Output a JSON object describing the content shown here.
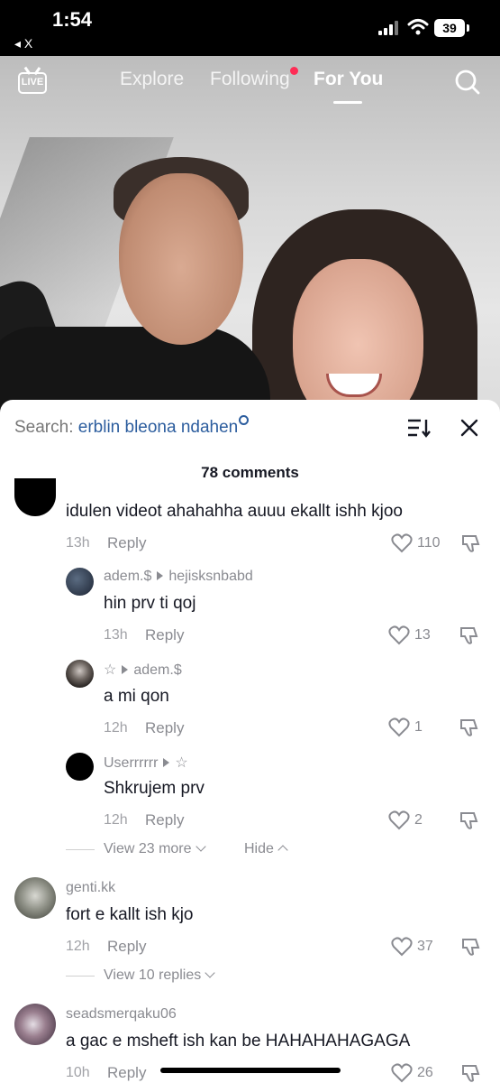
{
  "status": {
    "time": "1:54",
    "back_label": "◂ X",
    "battery": "39"
  },
  "topnav": {
    "tabs": [
      "Explore",
      "Following",
      "For You"
    ],
    "active_tab": "For You",
    "live_label": "LIVE"
  },
  "sheet": {
    "search_prefix": "Search:",
    "search_query": "erblin bleona ndahen",
    "comments_count": "78 comments"
  },
  "comments": [
    {
      "username": "",
      "text": "idulen videot ahahahha auuu ekallt ishh kjoo",
      "time": "13h",
      "reply": "Reply",
      "likes": "110"
    },
    {
      "username": "adem.$",
      "reply_to": "hejisksnbabd",
      "text": "hin prv ti qoj",
      "time": "13h",
      "reply": "Reply",
      "likes": "13"
    },
    {
      "username": "☆",
      "reply_to": "adem.$",
      "text": "a mi qon",
      "time": "12h",
      "reply": "Reply",
      "likes": "1"
    },
    {
      "username": "Userrrrrr",
      "reply_to": "☆",
      "text": "Shkrujem prv",
      "time": "12h",
      "reply": "Reply",
      "likes": "2"
    },
    {
      "username": "genti.kk",
      "text": "fort e kallt ish kjo",
      "time": "12h",
      "reply": "Reply",
      "likes": "37"
    },
    {
      "username": "seadsmerqaku06",
      "text": "a gac e msheft ish kan be HAHAHAHAGAGA",
      "time": "10h",
      "reply": "Reply",
      "likes": "26"
    }
  ],
  "thread_controls": {
    "view_more": "View 23 more",
    "hide": "Hide",
    "view_replies": "View 10 replies"
  },
  "colors": {
    "accent_dot": "#fe2c55",
    "search_query": "#2c5d9e"
  }
}
